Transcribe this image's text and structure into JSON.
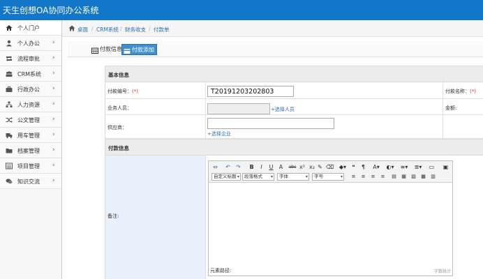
{
  "header": {
    "title": "天生创想OA协同办公系统"
  },
  "sidebar": {
    "items": [
      {
        "label": "个人门户",
        "icon": "home-icon",
        "active": true
      },
      {
        "label": "个人办公",
        "icon": "user-icon"
      },
      {
        "label": "流程审批",
        "icon": "retweet-icon"
      },
      {
        "label": "CRM系统",
        "icon": "group-icon"
      },
      {
        "label": "行政办公",
        "icon": "briefcase-icon"
      },
      {
        "label": "人力资源",
        "icon": "sitemap-icon"
      },
      {
        "label": "公文管理",
        "icon": "random-icon"
      },
      {
        "label": "用车管理",
        "icon": "truck-icon"
      },
      {
        "label": "档案管理",
        "icon": "folder-icon"
      },
      {
        "label": "项目管理",
        "icon": "list-icon"
      },
      {
        "label": "知识交流",
        "icon": "comments-icon"
      }
    ],
    "arrow": "›"
  },
  "breadcrumb": {
    "items": [
      "桌面",
      "CRM系统",
      "财务收支",
      "付款单"
    ],
    "separator": "/"
  },
  "tabs": {
    "info": "付款信息",
    "add": "付款添加"
  },
  "form": {
    "basic_title": "基本信息",
    "payment_no_label": "付款编号：",
    "payment_no_value": "T20191203202803",
    "payment_name_label": "付款名称：",
    "required_mark": "(*)",
    "staff_label": "业务人员：",
    "select_staff": "+选择人员",
    "amount_label": "金额:",
    "supplier_label": "供应商：",
    "select_company": "+选择企业",
    "payment_title": "付款信息",
    "remark_label": "备注:"
  },
  "editor": {
    "toolbar_row1": [
      "⇔",
      "↶",
      "↷",
      "B",
      "I",
      "U",
      "A",
      "abc",
      "x²",
      "x₂",
      "✎",
      "⌫",
      "◆▾",
      "❝",
      "¶",
      "A▾",
      "◐▾",
      "≡▾",
      "≣▾",
      "▭",
      "▣"
    ],
    "toolbar_row2": [
      "≡",
      "≡",
      "≡",
      "≡",
      "▤",
      "▦",
      "▨",
      "▩",
      "▥"
    ],
    "selects": [
      {
        "label": "自定义标题"
      },
      {
        "label": "段落格式"
      },
      {
        "label": "字体"
      },
      {
        "label": "字号"
      }
    ],
    "path_label": "元素路径:",
    "word_count": "字数统计"
  },
  "colors": {
    "header": "#1277c9",
    "link": "#2a6fb0",
    "required": "#d22222",
    "tab_active": "#3f8fd0"
  }
}
